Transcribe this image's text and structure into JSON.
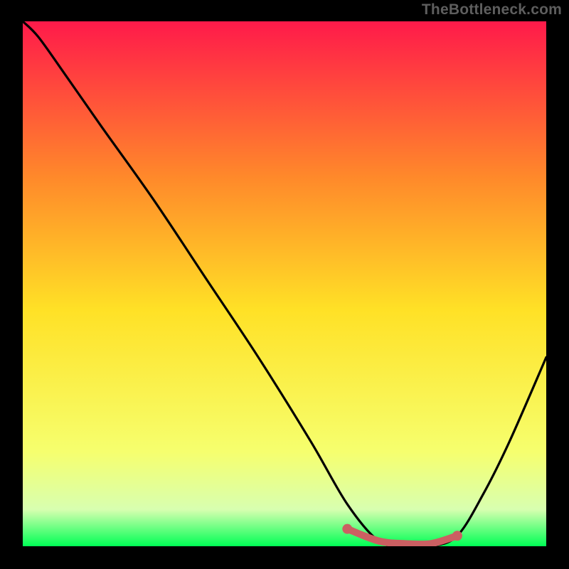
{
  "attribution": "TheBottleneck.com",
  "colors": {
    "page_bg": "#000000",
    "attribution_text": "#5e5e5e",
    "curve": "#000000",
    "highlight": "#cb5f62",
    "gradient_top": "#ff1a4a",
    "gradient_mid_upper": "#ff8a2a",
    "gradient_mid": "#ffe126",
    "gradient_lower": "#f6ff6e",
    "gradient_bottom": "#00ff55"
  },
  "chart_data": {
    "type": "line",
    "title": "",
    "xlabel": "",
    "ylabel": "",
    "xlim": [
      0,
      1
    ],
    "ylim": [
      0,
      1
    ],
    "series": [
      {
        "name": "bottleneck-curve",
        "x": [
          0.0,
          0.03,
          0.08,
          0.15,
          0.25,
          0.35,
          0.45,
          0.55,
          0.62,
          0.68,
          0.73,
          0.78,
          0.83,
          0.88,
          0.93,
          1.0
        ],
        "y": [
          1.0,
          0.97,
          0.9,
          0.8,
          0.66,
          0.51,
          0.36,
          0.2,
          0.08,
          0.01,
          0.0,
          0.0,
          0.02,
          0.1,
          0.2,
          0.36
        ]
      }
    ],
    "highlight_segment": {
      "name": "trough-highlight",
      "x": [
        0.62,
        0.68,
        0.73,
        0.78,
        0.83
      ],
      "y": [
        0.033,
        0.01,
        0.005,
        0.005,
        0.02
      ]
    },
    "highlight_endpoints": [
      {
        "x": 0.62,
        "y": 0.033
      },
      {
        "x": 0.83,
        "y": 0.02
      }
    ]
  }
}
